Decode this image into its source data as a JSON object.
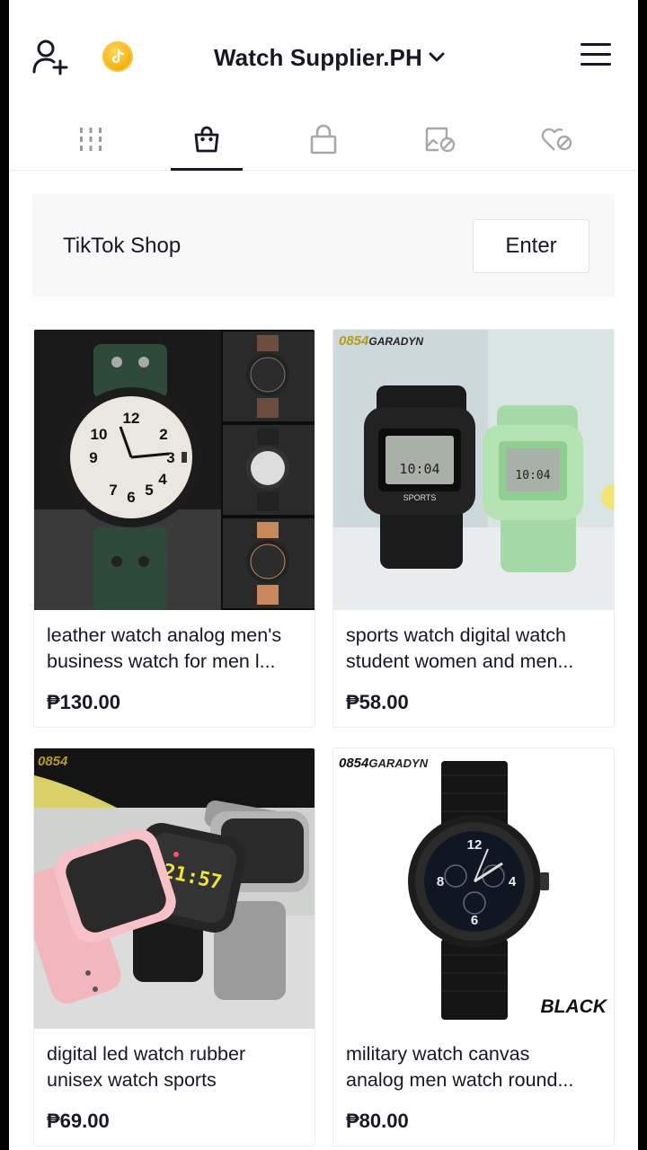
{
  "header": {
    "title": "Watch Supplier.PH"
  },
  "tabs": [
    {
      "name": "videos",
      "active": false
    },
    {
      "name": "shop",
      "active": true
    },
    {
      "name": "private",
      "active": false
    },
    {
      "name": "reposts",
      "active": false
    },
    {
      "name": "liked",
      "active": false
    }
  ],
  "shop_banner": {
    "label": "TikTok Shop",
    "button_label": "Enter"
  },
  "products": [
    {
      "name_line1": "leather watch analog men's",
      "name_line2": "business watch for men l...",
      "price": "₱130.00"
    },
    {
      "name_line1": "sports watch digital watch",
      "name_line2": "student women and men...",
      "price": "₱58.00",
      "brand_num": "0854",
      "brand_name": "GARADYN"
    },
    {
      "name_line1": "digital led watch rubber",
      "name_line2": "unisex watch sports",
      "price": "₱69.00",
      "brand_num": "0854"
    },
    {
      "name_line1": "military watch canvas",
      "name_line2": "analog men watch round...",
      "price": "₱80.00",
      "brand_num": "0854",
      "brand_name": "GARADYN",
      "color_tag": "BLACK"
    }
  ],
  "colors": {
    "text": "#161823",
    "banner_bg": "#f8f8f8",
    "coin": "#f3b416"
  }
}
